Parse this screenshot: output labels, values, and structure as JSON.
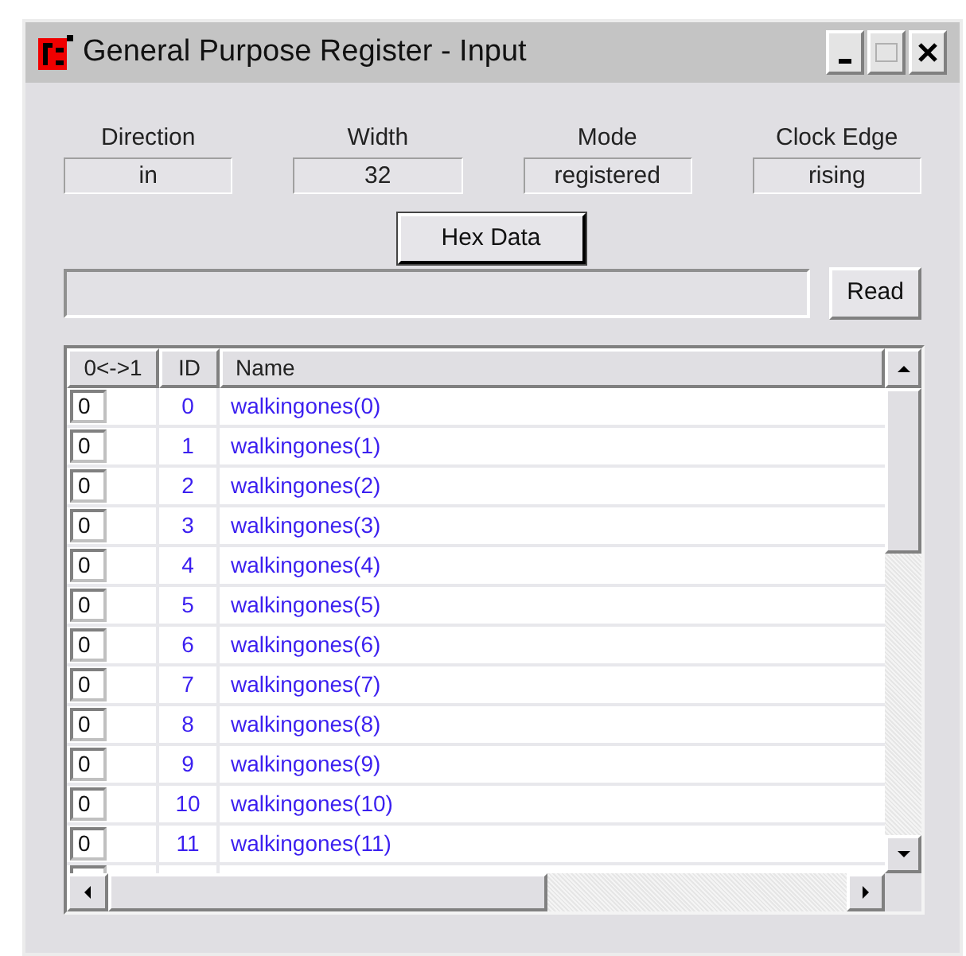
{
  "window": {
    "title": "General Purpose Register - Input"
  },
  "properties": [
    {
      "label": "Direction",
      "value": "in"
    },
    {
      "label": "Width",
      "value": "32"
    },
    {
      "label": "Mode",
      "value": "registered"
    },
    {
      "label": "Clock Edge",
      "value": "rising"
    }
  ],
  "hex_button": "Hex Data",
  "read_button": "Read",
  "table": {
    "columns": [
      "0<->1",
      "ID",
      "Name"
    ],
    "rows": [
      {
        "bit": "0",
        "id": "0",
        "name": "walkingones(0)"
      },
      {
        "bit": "0",
        "id": "1",
        "name": "walkingones(1)"
      },
      {
        "bit": "0",
        "id": "2",
        "name": "walkingones(2)"
      },
      {
        "bit": "0",
        "id": "3",
        "name": "walkingones(3)"
      },
      {
        "bit": "0",
        "id": "4",
        "name": "walkingones(4)"
      },
      {
        "bit": "0",
        "id": "5",
        "name": "walkingones(5)"
      },
      {
        "bit": "0",
        "id": "6",
        "name": "walkingones(6)"
      },
      {
        "bit": "0",
        "id": "7",
        "name": "walkingones(7)"
      },
      {
        "bit": "0",
        "id": "8",
        "name": "walkingones(8)"
      },
      {
        "bit": "0",
        "id": "9",
        "name": "walkingones(9)"
      },
      {
        "bit": "0",
        "id": "10",
        "name": "walkingones(10)"
      },
      {
        "bit": "0",
        "id": "11",
        "name": "walkingones(11)"
      }
    ]
  }
}
